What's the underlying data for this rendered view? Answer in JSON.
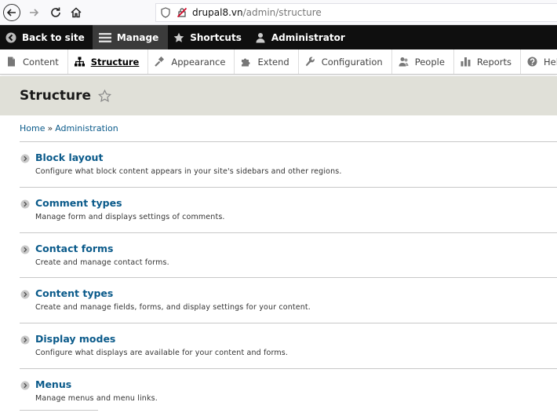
{
  "browser": {
    "url_host": "drupal8.vn",
    "url_path": "/admin/structure"
  },
  "toolbar": {
    "back_to_site": "Back to site",
    "manage": "Manage",
    "shortcuts": "Shortcuts",
    "user": "Administrator"
  },
  "tray": {
    "items": [
      {
        "label": "Content",
        "icon": "file-icon"
      },
      {
        "label": "Structure",
        "icon": "sitemap-icon"
      },
      {
        "label": "Appearance",
        "icon": "paint-icon"
      },
      {
        "label": "Extend",
        "icon": "puzzle-icon"
      },
      {
        "label": "Configuration",
        "icon": "wrench-icon"
      },
      {
        "label": "People",
        "icon": "people-icon"
      },
      {
        "label": "Reports",
        "icon": "bar-chart-icon"
      },
      {
        "label": "Help",
        "icon": "help-icon"
      }
    ]
  },
  "page": {
    "title": "Structure"
  },
  "breadcrumb": {
    "home": "Home",
    "separator": "»",
    "admin": "Administration"
  },
  "items": [
    {
      "title": "Block layout",
      "desc": "Configure what block content appears in your site's sidebars and other regions."
    },
    {
      "title": "Comment types",
      "desc": "Manage form and displays settings of comments."
    },
    {
      "title": "Contact forms",
      "desc": "Create and manage contact forms."
    },
    {
      "title": "Content types",
      "desc": "Create and manage fields, forms, and display settings for your content."
    },
    {
      "title": "Display modes",
      "desc": "Configure what displays are available for your content and forms."
    },
    {
      "title": "Menus",
      "desc": "Manage menus and menu links."
    }
  ],
  "colors": {
    "link": "#0a5a8a",
    "toolbar_bg": "#0f0f0f",
    "header_bg": "#e0e0d8"
  }
}
